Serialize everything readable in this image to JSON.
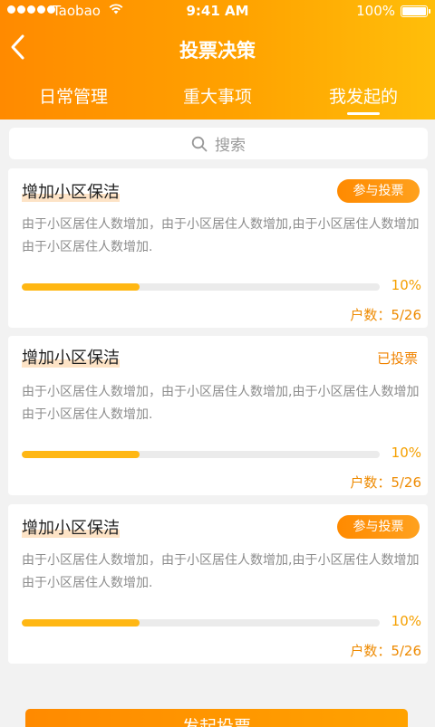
{
  "status_bar": {
    "carrier": "Taobao",
    "time": "9:41 AM",
    "battery": "100%"
  },
  "header": {
    "title": "投票决策"
  },
  "tabs": [
    {
      "label": "日常管理",
      "active": false
    },
    {
      "label": "重大事项",
      "active": false
    },
    {
      "label": "我发起的",
      "active": true
    }
  ],
  "search": {
    "placeholder": "搜索"
  },
  "cards": [
    {
      "title": "增加小区保洁",
      "action": "参与投票",
      "status": "",
      "description": "由于小区居住人数增加，由于小区居住人数增加,由于小区居住人数增加由于小区居住人数增加.",
      "progress_percent": 10,
      "progress_label": "10%",
      "households": "户数：5/26"
    },
    {
      "title": "增加小区保洁",
      "action": "",
      "status": "已投票",
      "description": "由于小区居住人数增加，由于小区居住人数增加,由于小区居住人数增加由于小区居住人数增加.",
      "progress_percent": 10,
      "progress_label": "10%",
      "households": "户数：5/26"
    },
    {
      "title": "增加小区保洁",
      "action": "参与投票",
      "status": "",
      "description": "由于小区居住人数增加，由于小区居住人数增加,由于小区居住人数增加由于小区居住人数增加.",
      "progress_percent": 10,
      "progress_label": "10%",
      "households": "户数：5/26"
    }
  ],
  "bottom_button": {
    "label": "发起投票"
  },
  "colors": {
    "accent": "#ff8a00",
    "accent_end": "#ffbe0a",
    "progress": "#ffb713",
    "highlight": "#fde3c6"
  }
}
